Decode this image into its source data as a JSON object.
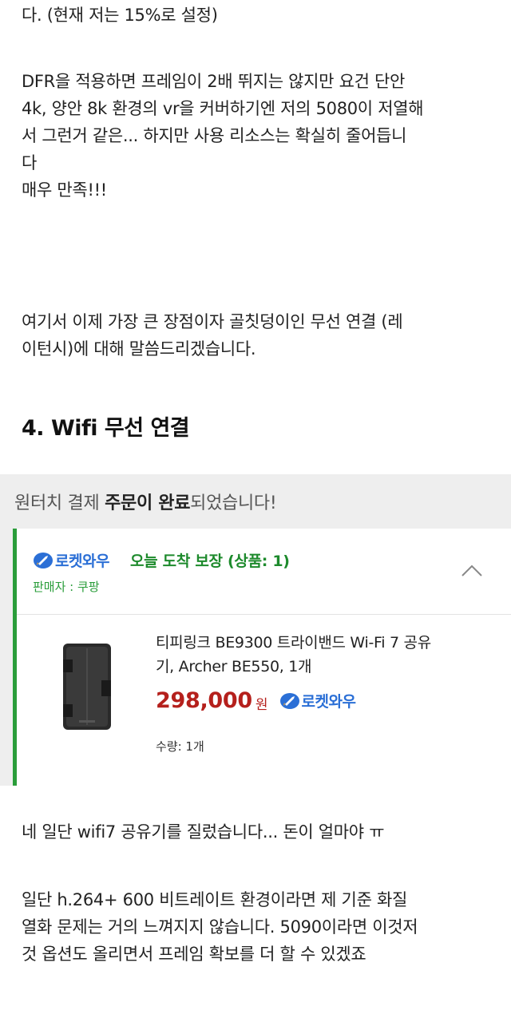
{
  "article": {
    "para1": "다. (현재 저는 15%로 설정)",
    "para2": "DFR을 적용하면 프레임이 2배 뛰지는 않지만 요건 단안\n4k, 양안 8k 환경의 vr을 커버하기엔 저의 5080이 저열해\n서 그런거 같은... 하지만 사용 리소스는 확실히 줄어듭니\n다\n매우 만족!!!",
    "para3": "여기서 이제 가장 큰 장점이자 골칫덩이인 무선 연결 (레\n이턴시)에 대해 말씀드리겠습니다.",
    "heading": "4. Wifi 무선 연결",
    "para4": "네 일단 wifi7 공유기를 질렀습니다... 돈이 얼마야 ㅠ",
    "para5": "일단 h.264+ 600 비트레이트 환경이라면 제 기준 화질\n열화 문제는 거의 느껴지지 않습니다. 5090이라면 이것저\n것 옵션도 올리면서 프레임 확보를 더 할 수 있겠죠"
  },
  "order": {
    "title_pre": "원터치 결제 ",
    "title_bold1": "주문이 완료",
    "title_post": "되었습니다!",
    "rocket_badge": "로켓와우",
    "delivery": "오늘 도착 보장 (상품: 1)",
    "seller": "판매자 : 쿠팡",
    "product_name": "티피링크 BE9300 트라이밴드 Wi-Fi 7 공유\n기, Archer BE550, 1개",
    "price": "298,000",
    "currency": "원",
    "quantity": "수량: 1개",
    "accent_color": "#2a9d3a",
    "price_color": "#b5201c",
    "rocket_color": "#2b6fd6"
  }
}
